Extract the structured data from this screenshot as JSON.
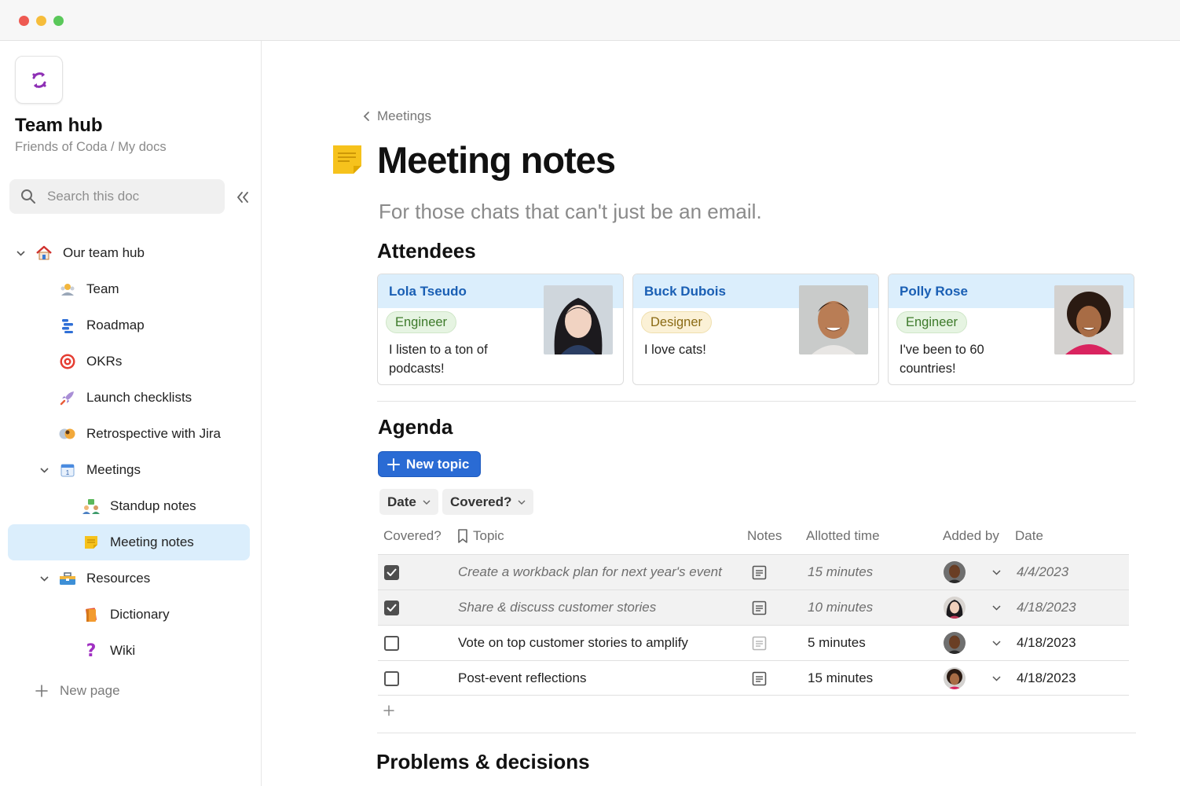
{
  "sidebar": {
    "doc_title": "Team hub",
    "doc_path": "Friends of Coda / My docs",
    "search_placeholder": "Search this doc",
    "items": [
      {
        "label": "Our team hub"
      },
      {
        "label": "Team"
      },
      {
        "label": "Roadmap"
      },
      {
        "label": "OKRs"
      },
      {
        "label": "Launch checklists"
      },
      {
        "label": "Retrospective with Jira"
      },
      {
        "label": "Meetings"
      },
      {
        "label": "Standup notes"
      },
      {
        "label": "Meeting notes"
      },
      {
        "label": "Resources"
      },
      {
        "label": "Dictionary"
      },
      {
        "label": "Wiki"
      }
    ],
    "new_page": "New page"
  },
  "page": {
    "breadcrumb": "Meetings",
    "title": "Meeting notes",
    "subtitle": "For those chats that can't just be an email.",
    "attendees_heading": "Attendees",
    "agenda_heading": "Agenda",
    "problems_heading": "Problems & decisions"
  },
  "attendees": [
    {
      "name": "Lola Tseudo",
      "role": "Engineer",
      "bio": "I listen to a ton of podcasts!"
    },
    {
      "name": "Buck Dubois",
      "role": "Designer",
      "bio": "I love cats!"
    },
    {
      "name": "Polly Rose",
      "role": "Engineer",
      "bio": "I've been to 60 countries!"
    }
  ],
  "agenda": {
    "new_topic": "New topic",
    "filters": [
      "Date",
      "Covered?"
    ],
    "columns": [
      "Covered?",
      "Topic",
      "Notes",
      "Allotted time",
      "Added by",
      "Date"
    ],
    "rows": [
      {
        "covered": true,
        "topic": "Create a workback plan for next year's event",
        "time": "15 minutes",
        "date": "4/4/2023"
      },
      {
        "covered": true,
        "topic": "Share & discuss customer stories",
        "time": "10 minutes",
        "date": "4/18/2023"
      },
      {
        "covered": false,
        "topic": "Vote on top customer stories to amplify",
        "time": "5 minutes",
        "date": "4/18/2023"
      },
      {
        "covered": false,
        "topic": "Post-event reflections",
        "time": "15 minutes",
        "date": "4/18/2023"
      }
    ]
  },
  "colors": {
    "accent_blue": "#2a6bd4",
    "active_nav": "#dbeefc",
    "card_header": "#dbeefc",
    "engineer_tag": "#e6f4e2",
    "designer_tag": "#fbf1d6"
  }
}
